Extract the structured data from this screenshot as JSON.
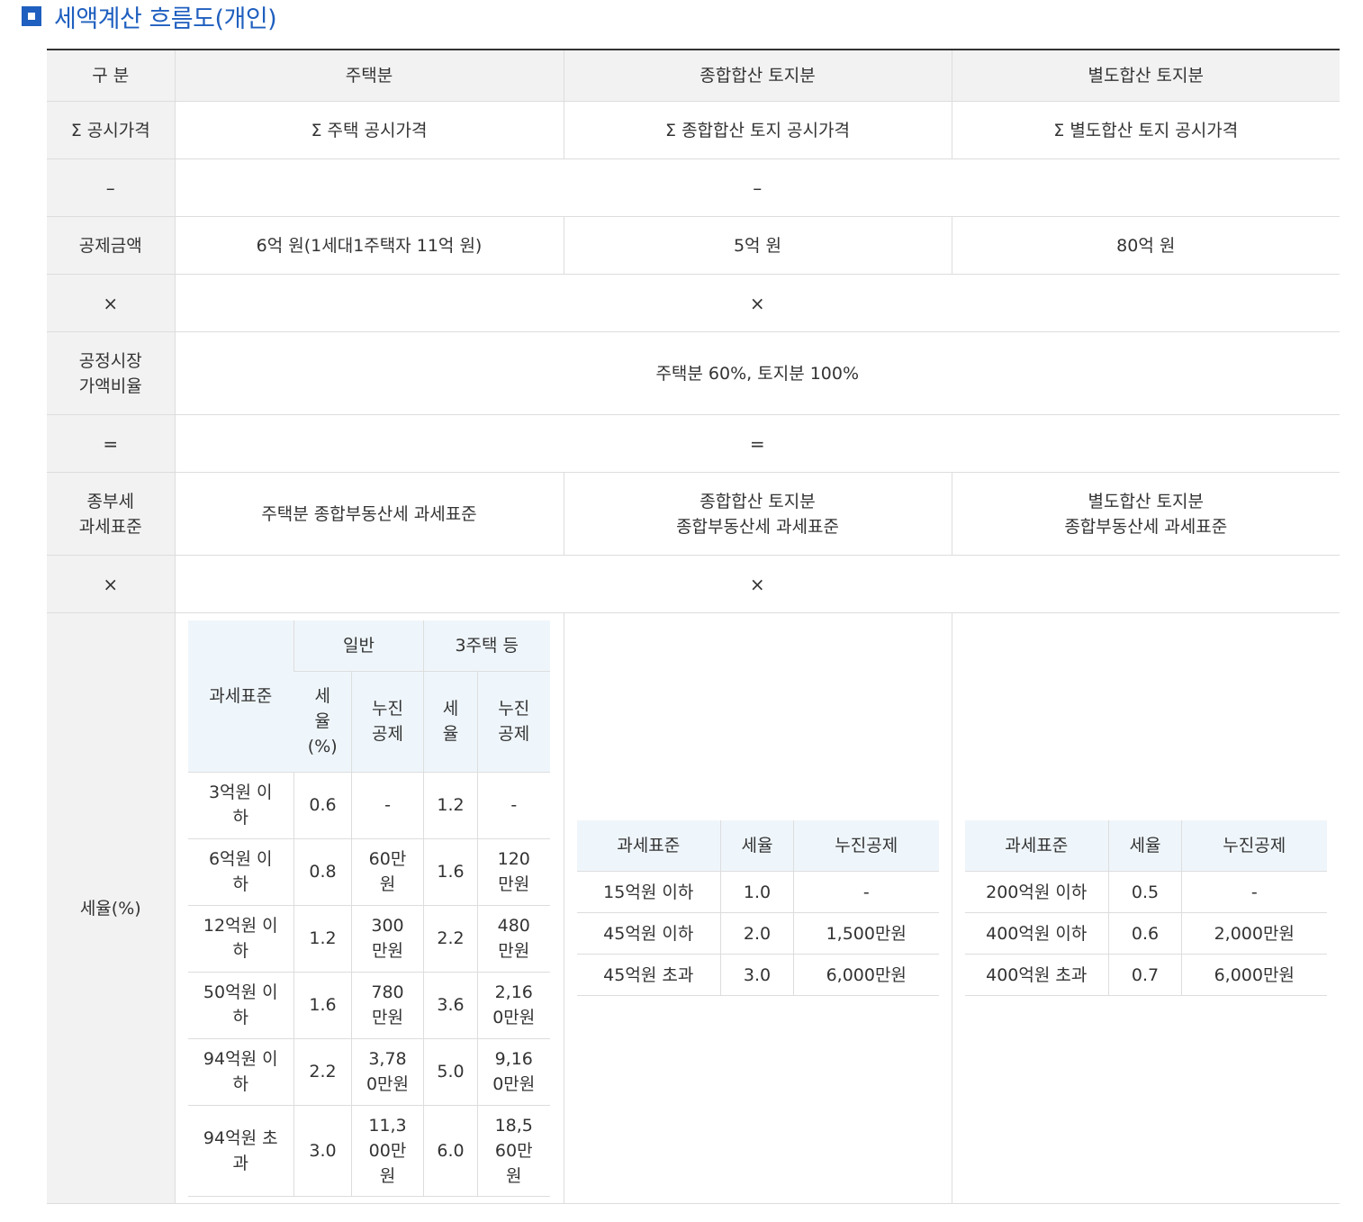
{
  "heading": {
    "title": "세액계산 흐름도(개인)"
  },
  "table": {
    "headers": [
      "구 분",
      "주택분",
      "종합합산 토지분",
      "별도합산 토지분"
    ],
    "row_price": {
      "label": "Σ 공시가격",
      "house": "Σ 주택 공시가격",
      "comp": "Σ 종합합산 토지 공시가격",
      "sep": "Σ 별도합산 토지 공시가격"
    },
    "op_minus": {
      "label": "–",
      "value": "–"
    },
    "row_deduct": {
      "label": "공제금액",
      "house": "6억 원(1세대1주택자 11억 원)",
      "comp": "5억 원",
      "sep": "80억 원"
    },
    "op_times1": {
      "label": "×",
      "value": "×"
    },
    "row_ratio": {
      "label_l1": "공정시장",
      "label_l2": "가액비율",
      "value": "주택분 60%, 토지분 100%"
    },
    "op_equals": {
      "label": "=",
      "value": "="
    },
    "row_base": {
      "label_l1": "종부세",
      "label_l2": "과세표준",
      "house": "주택분 종합부동산세 과세표준",
      "comp_l1": "종합합산 토지분",
      "comp_l2": "종합부동산세 과세표준",
      "sep_l1": "별도합산 토지분",
      "sep_l2": "종합부동산세 과세표준"
    },
    "op_times2": {
      "label": "×",
      "value": "×"
    },
    "row_rate": {
      "label": "세율(%)"
    }
  },
  "house_rates": {
    "h_base": "과세표준",
    "h_general": "일반",
    "h_three": "3주택 등",
    "h_rate_l1": "세",
    "h_rate_l2": "율",
    "h_rate_l3": "(%)",
    "h_ded_l1": "누진",
    "h_ded_l2": "공제",
    "h_rate2_l1": "세",
    "h_rate2_l2": "율",
    "h_ded2_l1": "누진",
    "h_ded2_l2": "공제",
    "rows": [
      {
        "b1": "3억원 이",
        "b2": "하",
        "r1": "0.6",
        "d1a": "-",
        "d1b": "",
        "d1c": "",
        "r2": "1.2",
        "d2a": "-",
        "d2b": "",
        "d2c": ""
      },
      {
        "b1": "6억원 이",
        "b2": "하",
        "r1": "0.8",
        "d1a": "60만",
        "d1b": "원",
        "d1c": "",
        "r2": "1.6",
        "d2a": "120",
        "d2b": "만원",
        "d2c": ""
      },
      {
        "b1": "12억원 이",
        "b2": "하",
        "r1": "1.2",
        "d1a": "300",
        "d1b": "만원",
        "d1c": "",
        "r2": "2.2",
        "d2a": "480",
        "d2b": "만원",
        "d2c": ""
      },
      {
        "b1": "50억원 이",
        "b2": "하",
        "r1": "1.6",
        "d1a": "780",
        "d1b": "만원",
        "d1c": "",
        "r2": "3.6",
        "d2a": "2,16",
        "d2b": "0만원",
        "d2c": ""
      },
      {
        "b1": "94억원 이",
        "b2": "하",
        "r1": "2.2",
        "d1a": "3,78",
        "d1b": "0만원",
        "d1c": "",
        "r2": "5.0",
        "d2a": "9,16",
        "d2b": "0만원",
        "d2c": ""
      },
      {
        "b1": "94억원 초",
        "b2": "과",
        "r1": "3.0",
        "d1a": "11,3",
        "d1b": "00만",
        "d1c": "원",
        "r2": "6.0",
        "d2a": "18,5",
        "d2b": "60만",
        "d2c": "원"
      }
    ]
  },
  "comp_rates": {
    "headers": [
      "과세표준",
      "세율",
      "누진공제"
    ],
    "rows": [
      [
        "15억원 이하",
        "1.0",
        "-"
      ],
      [
        "45억원 이하",
        "2.0",
        "1,500만원"
      ],
      [
        "45억원 초과",
        "3.0",
        "6,000만원"
      ]
    ]
  },
  "sep_rates": {
    "headers": [
      "과세표준",
      "세율",
      "누진공제"
    ],
    "rows": [
      [
        "200억원 이하",
        "0.5",
        "-"
      ],
      [
        "400억원 이하",
        "0.6",
        "2,000만원"
      ],
      [
        "400억원 초과",
        "0.7",
        "6,000만원"
      ]
    ]
  }
}
